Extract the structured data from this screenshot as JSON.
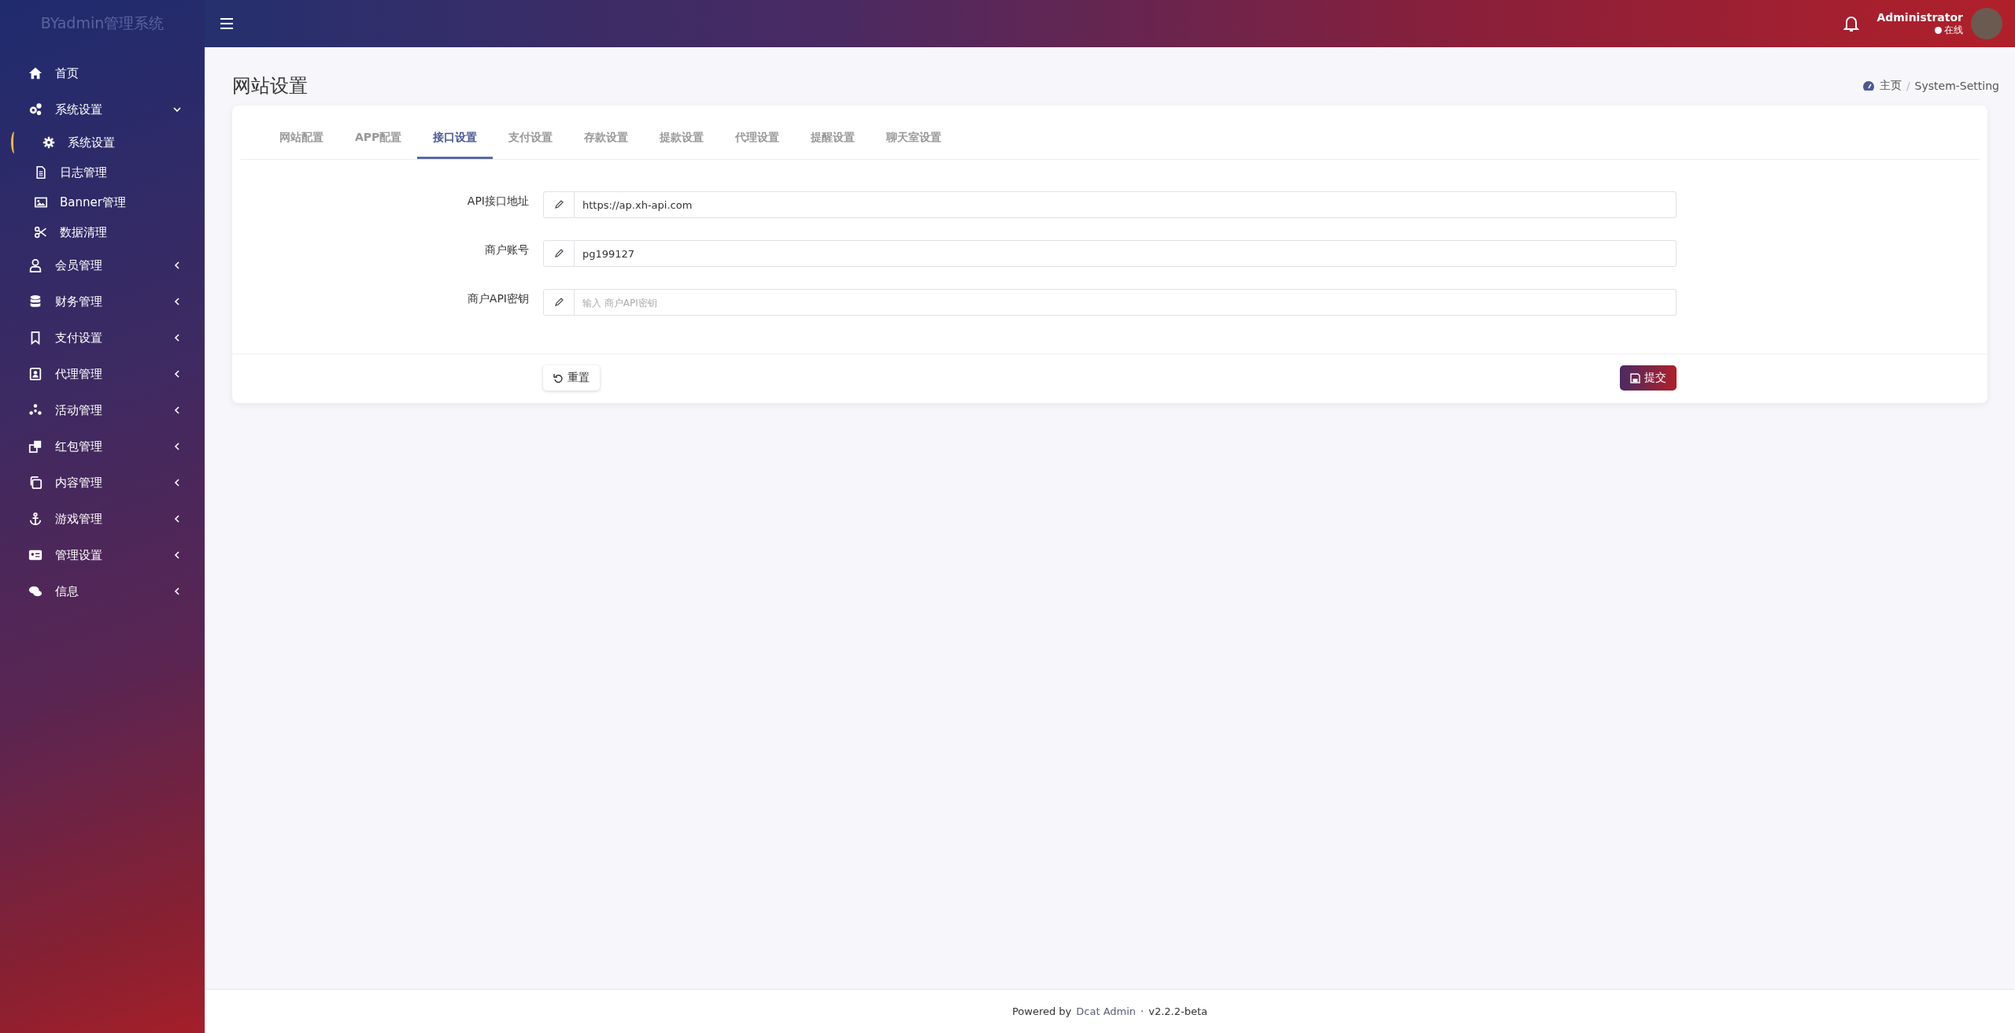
{
  "sidebar": {
    "brand": "BYadmin管理系统",
    "items": [
      {
        "label": "首页"
      },
      {
        "label": "系统设置",
        "expanded": true,
        "children": [
          {
            "label": "系统设置",
            "selected": true
          },
          {
            "label": "日志管理",
            "selected": false
          },
          {
            "label": "Banner管理",
            "selected": false
          },
          {
            "label": "数据清理",
            "selected": false
          }
        ]
      },
      {
        "label": "会员管理",
        "expanded": false
      },
      {
        "label": "财务管理",
        "expanded": false
      },
      {
        "label": "支付设置",
        "expanded": false
      },
      {
        "label": "代理管理",
        "expanded": false
      },
      {
        "label": "活动管理",
        "expanded": false
      },
      {
        "label": "红包管理",
        "expanded": false
      },
      {
        "label": "内容管理",
        "expanded": false
      },
      {
        "label": "游戏管理",
        "expanded": false
      },
      {
        "label": "管理设置",
        "expanded": false
      },
      {
        "label": "信息",
        "expanded": false
      }
    ]
  },
  "header": {
    "user": {
      "name": "Administrator",
      "status": "在线",
      "online": true
    }
  },
  "page": {
    "title": "网站设置",
    "breadcrumb": [
      {
        "label": "主页"
      },
      {
        "label": "System-Setting"
      }
    ],
    "breadcrumb_separator": "/"
  },
  "tabs": [
    {
      "label": "网站配置",
      "selected": false
    },
    {
      "label": "APP配置",
      "selected": false
    },
    {
      "label": "接口设置",
      "selected": true
    },
    {
      "label": "支付设置",
      "selected": false
    },
    {
      "label": "存款设置",
      "selected": false
    },
    {
      "label": "提款设置",
      "selected": false
    },
    {
      "label": "代理设置",
      "selected": false
    },
    {
      "label": "提醒设置",
      "selected": false
    },
    {
      "label": "聊天室设置",
      "selected": false
    }
  ],
  "form": {
    "fields": [
      {
        "label": "API接口地址",
        "value": "https://ap.xh-api.com"
      },
      {
        "label": "商户账号",
        "value": "pg199127"
      },
      {
        "label": "商户API密钥",
        "placeholder": "输入 商户API密钥"
      }
    ],
    "buttons": [
      {
        "kind": "reset",
        "label": "重置"
      },
      {
        "kind": "submit",
        "label": "提交"
      }
    ]
  },
  "footer": {
    "prefix": "Powered by",
    "link": "Dcat Admin",
    "separator": "·",
    "version": "v2.2.2-beta"
  }
}
